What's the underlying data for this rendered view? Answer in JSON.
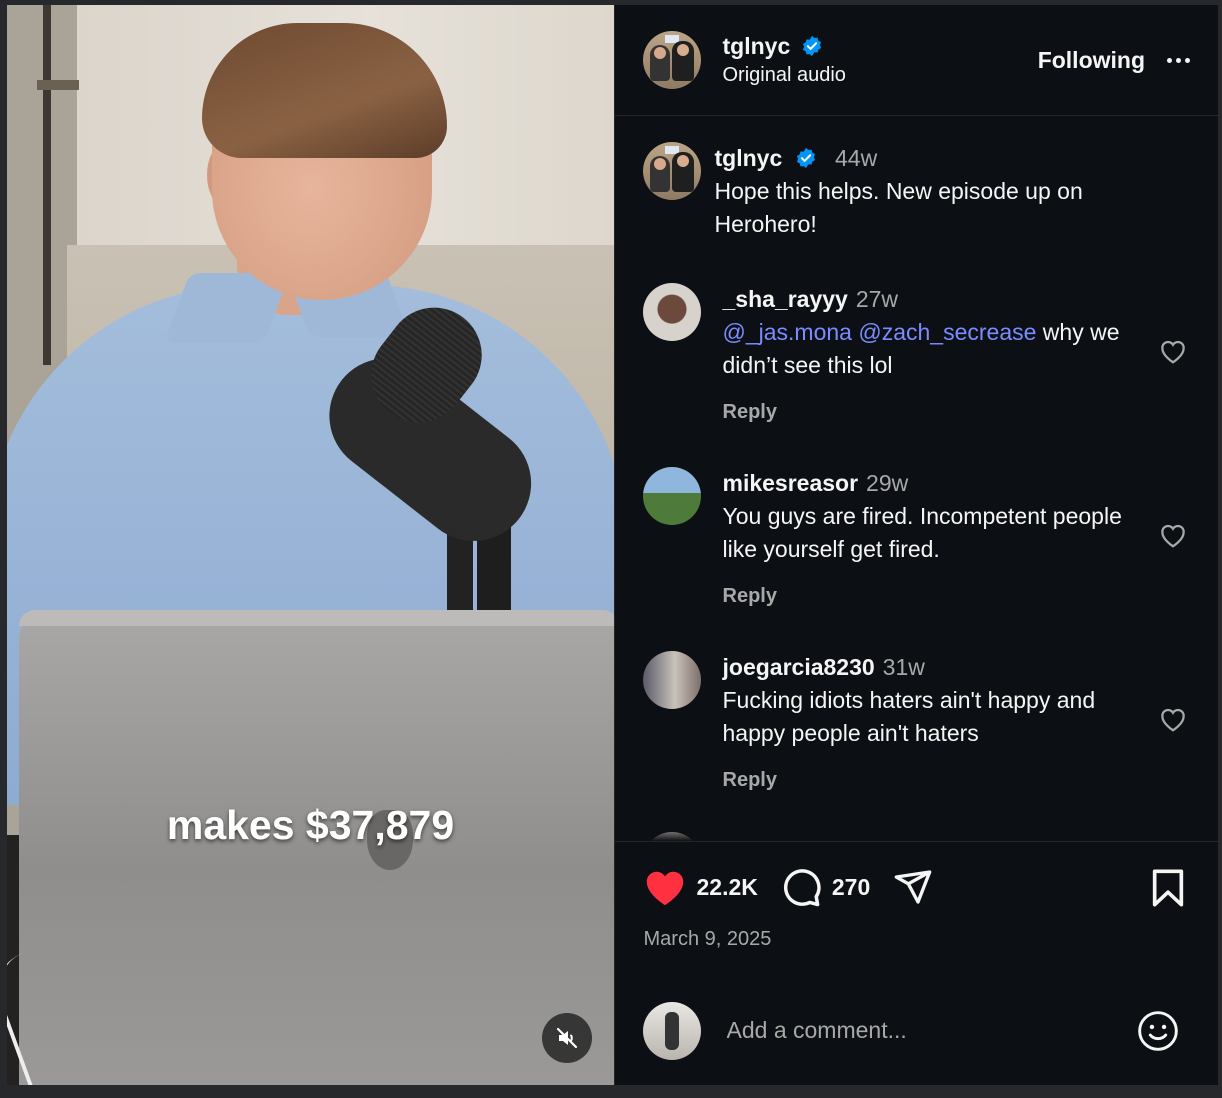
{
  "video": {
    "caption": "makes $37,879",
    "mute_icon": "speaker-muted-icon"
  },
  "header": {
    "username": "tglnyc",
    "subtitle": "Original audio",
    "follow_label": "Following",
    "more_icon": "more-horizontal-icon"
  },
  "caption_post": {
    "username": "tglnyc",
    "time": "44w",
    "text": "Hope this helps. New episode up on Herohero!"
  },
  "comments": [
    {
      "username": "_sha_rayyy",
      "time": "27w",
      "mentions": [
        "@_jas.mona",
        "@zach_secrease"
      ],
      "text": " why we didn’t see this lol",
      "reply": "Reply"
    },
    {
      "username": "mikesreasor",
      "time": "29w",
      "text": "You guys are fired. Incompetent people like yourself get fired.",
      "reply": "Reply"
    },
    {
      "username": "joegarcia8230",
      "time": "31w",
      "text": "Fucking idiots haters ain't happy and happy people ain't haters",
      "reply": "Reply"
    }
  ],
  "actions": {
    "likes": "22.2K",
    "comments": "270",
    "date": "March 9, 2025",
    "like_color": "#ff3040"
  },
  "composer": {
    "placeholder": "Add a comment..."
  },
  "colors": {
    "background": "#0c1014",
    "mention": "#7a8cff",
    "verified": "#0095f6"
  }
}
